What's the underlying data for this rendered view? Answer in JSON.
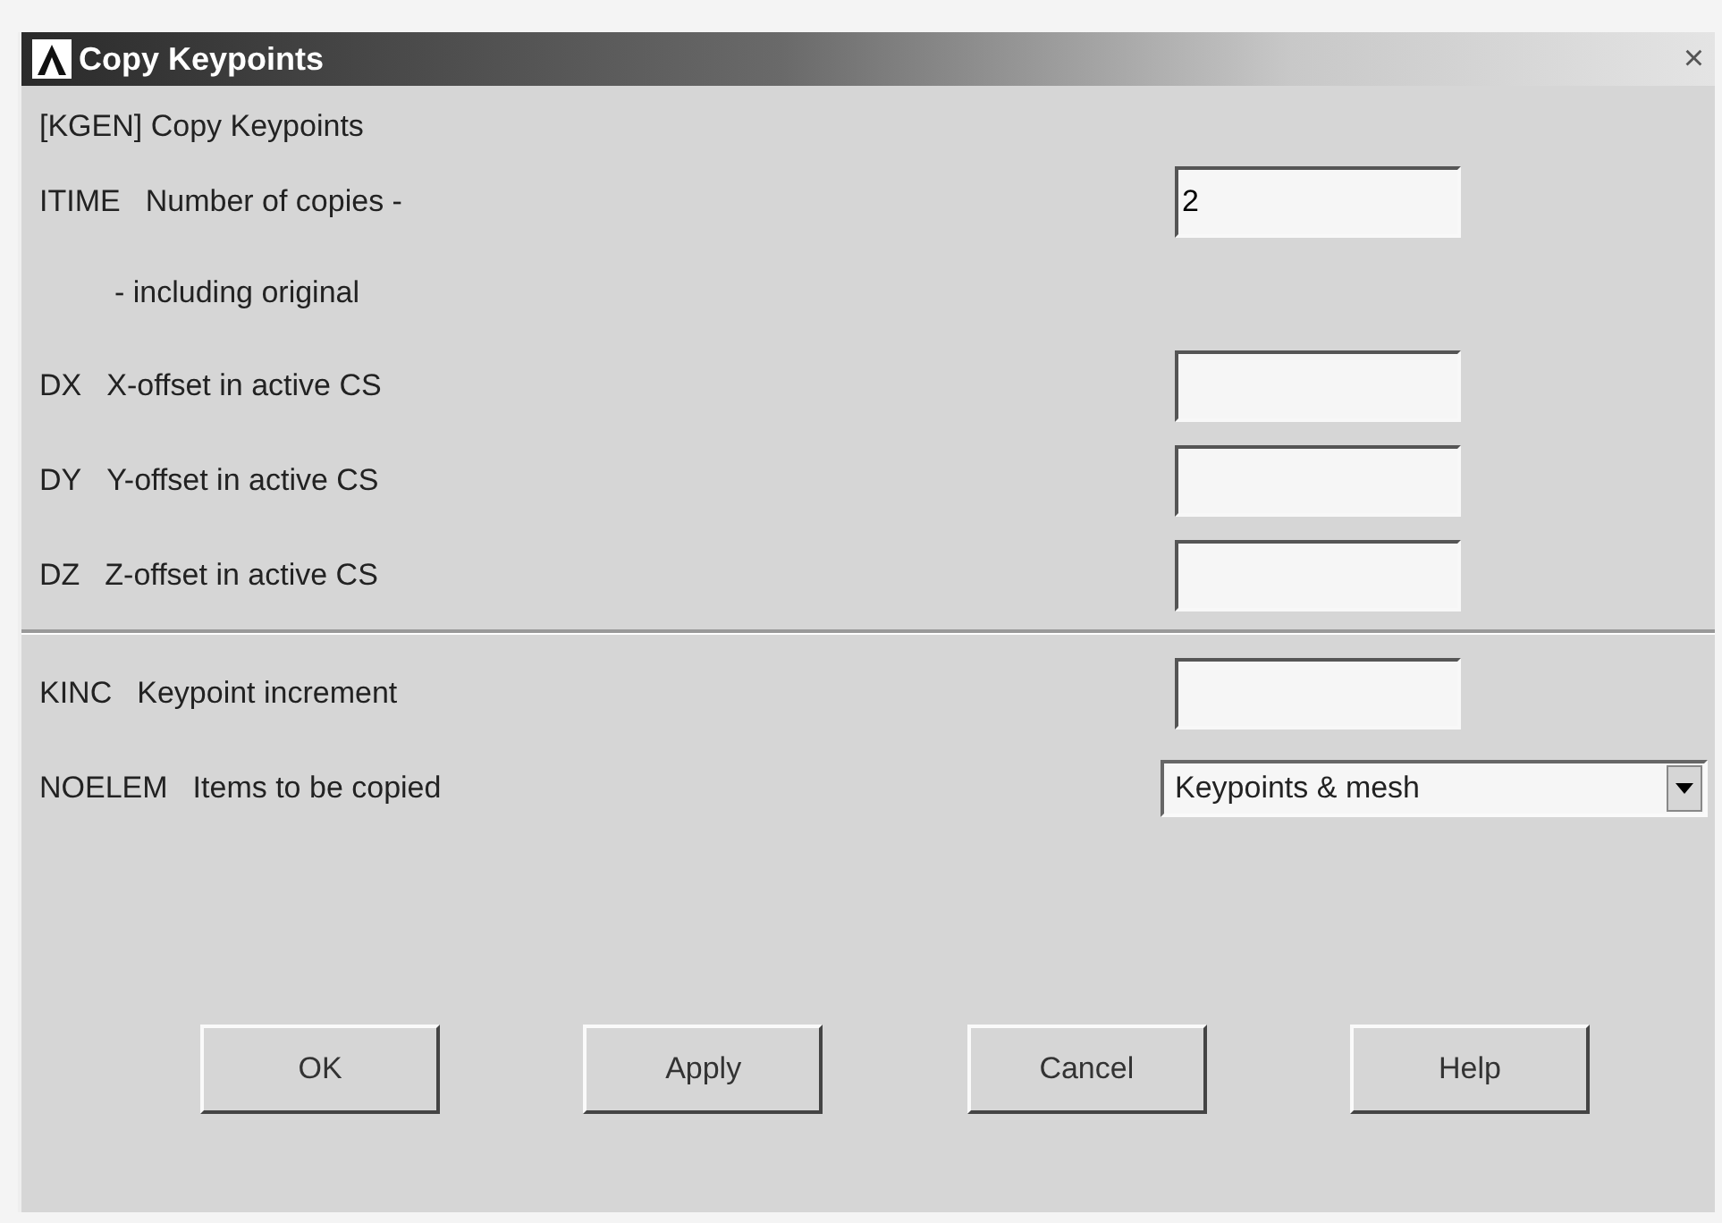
{
  "window": {
    "title": "Copy Keypoints",
    "close": "×"
  },
  "command_label": "[KGEN] Copy Keypoints",
  "rows": [
    {
      "kind": "input",
      "code": "ITIME",
      "label": "Number of copies -",
      "value": "2",
      "divider_before": false
    },
    {
      "kind": "note",
      "label": "- including original",
      "divider_before": false
    },
    {
      "kind": "input",
      "code": "DX",
      "label": "X-offset in active CS",
      "divider_before": false
    },
    {
      "kind": "input",
      "code": "DY",
      "label": "Y-offset in active CS",
      "divider_before": false
    },
    {
      "kind": "input",
      "code": "DZ",
      "label": "Z-offset in active CS",
      "divider_before": false
    },
    {
      "kind": "input",
      "code": "KINC",
      "label": "Keypoint increment",
      "divider_before": true
    },
    {
      "kind": "dropdown",
      "code": "NOELEM",
      "label": "Items to be copied",
      "value": "Keypoints & mesh",
      "divider_before": false
    }
  ],
  "buttons": [
    "OK",
    "Apply",
    "Cancel",
    "Help"
  ]
}
